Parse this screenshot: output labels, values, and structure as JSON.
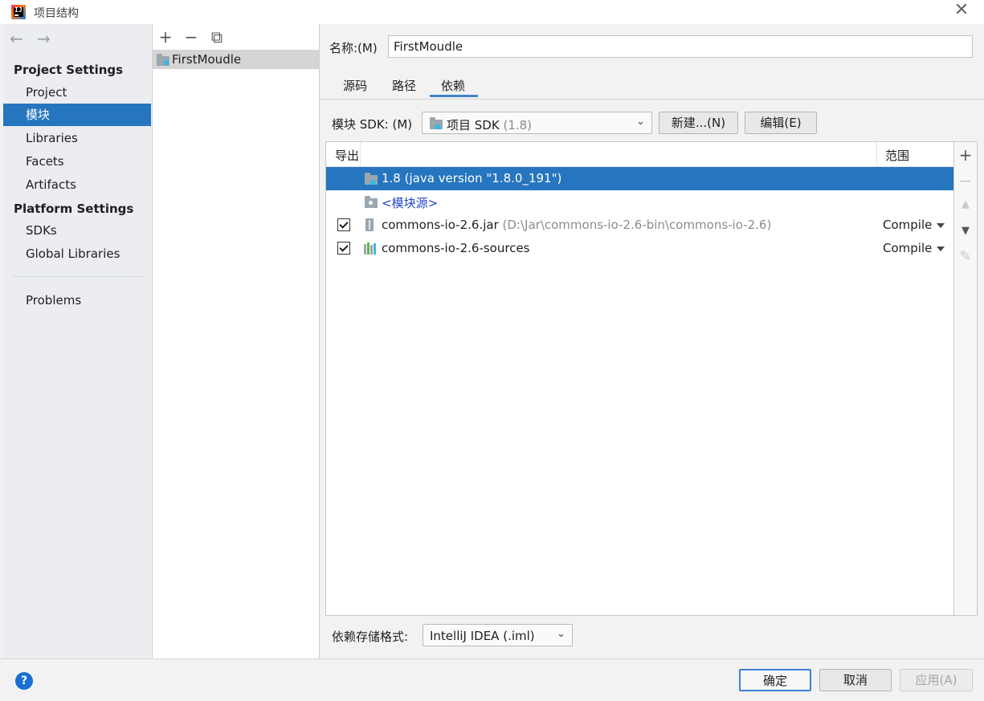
{
  "window": {
    "title": "项目结构"
  },
  "nav": {
    "back": "←",
    "forward": "→"
  },
  "sidebar": {
    "heading_project": "Project Settings",
    "heading_platform": "Platform Settings",
    "items": [
      {
        "label": "Project"
      },
      {
        "label": "模块"
      },
      {
        "label": "Libraries"
      },
      {
        "label": "Facets"
      },
      {
        "label": "Artifacts"
      },
      {
        "label": "SDKs"
      },
      {
        "label": "Global Libraries"
      },
      {
        "label": "Problems"
      }
    ]
  },
  "module_list": {
    "toolbar": {
      "add": "+",
      "remove": "−",
      "copy": "⧉"
    },
    "modules": [
      {
        "name": "FirstMoudle"
      }
    ]
  },
  "module": {
    "name_label": "名称:(M)",
    "name_value": "FirstMoudle",
    "tabs": [
      {
        "label": "源码"
      },
      {
        "label": "路径"
      },
      {
        "label": "依赖"
      }
    ],
    "sdk": {
      "label": "模块 SDK:",
      "mnemonic": "(M)",
      "value": "项目 SDK",
      "value_dim": "(1.8)",
      "new_button": "新建...(N)",
      "edit_button": "编辑(E)"
    },
    "dependencies": {
      "header_export": "导出",
      "header_scope": "范围",
      "rows": [
        {
          "name": "1.8 (java version \"1.8.0_191\")"
        },
        {
          "name": "<模块源>"
        },
        {
          "name": "commons-io-2.6.jar",
          "path": "(D:\\Jar\\commons-io-2.6-bin\\commons-io-2.6)",
          "scope": "Compile"
        },
        {
          "name": "commons-io-2.6-sources",
          "scope": "Compile"
        }
      ],
      "toolbar": {
        "add": "+",
        "remove": "−",
        "up": "▲",
        "down": "▼",
        "edit": "✎"
      }
    },
    "format": {
      "label": "依赖存储格式:",
      "value": "IntelliJ IDEA (.iml)"
    }
  },
  "footer": {
    "help": "?",
    "ok": "确定",
    "cancel": "取消",
    "apply": "应用(A)"
  }
}
